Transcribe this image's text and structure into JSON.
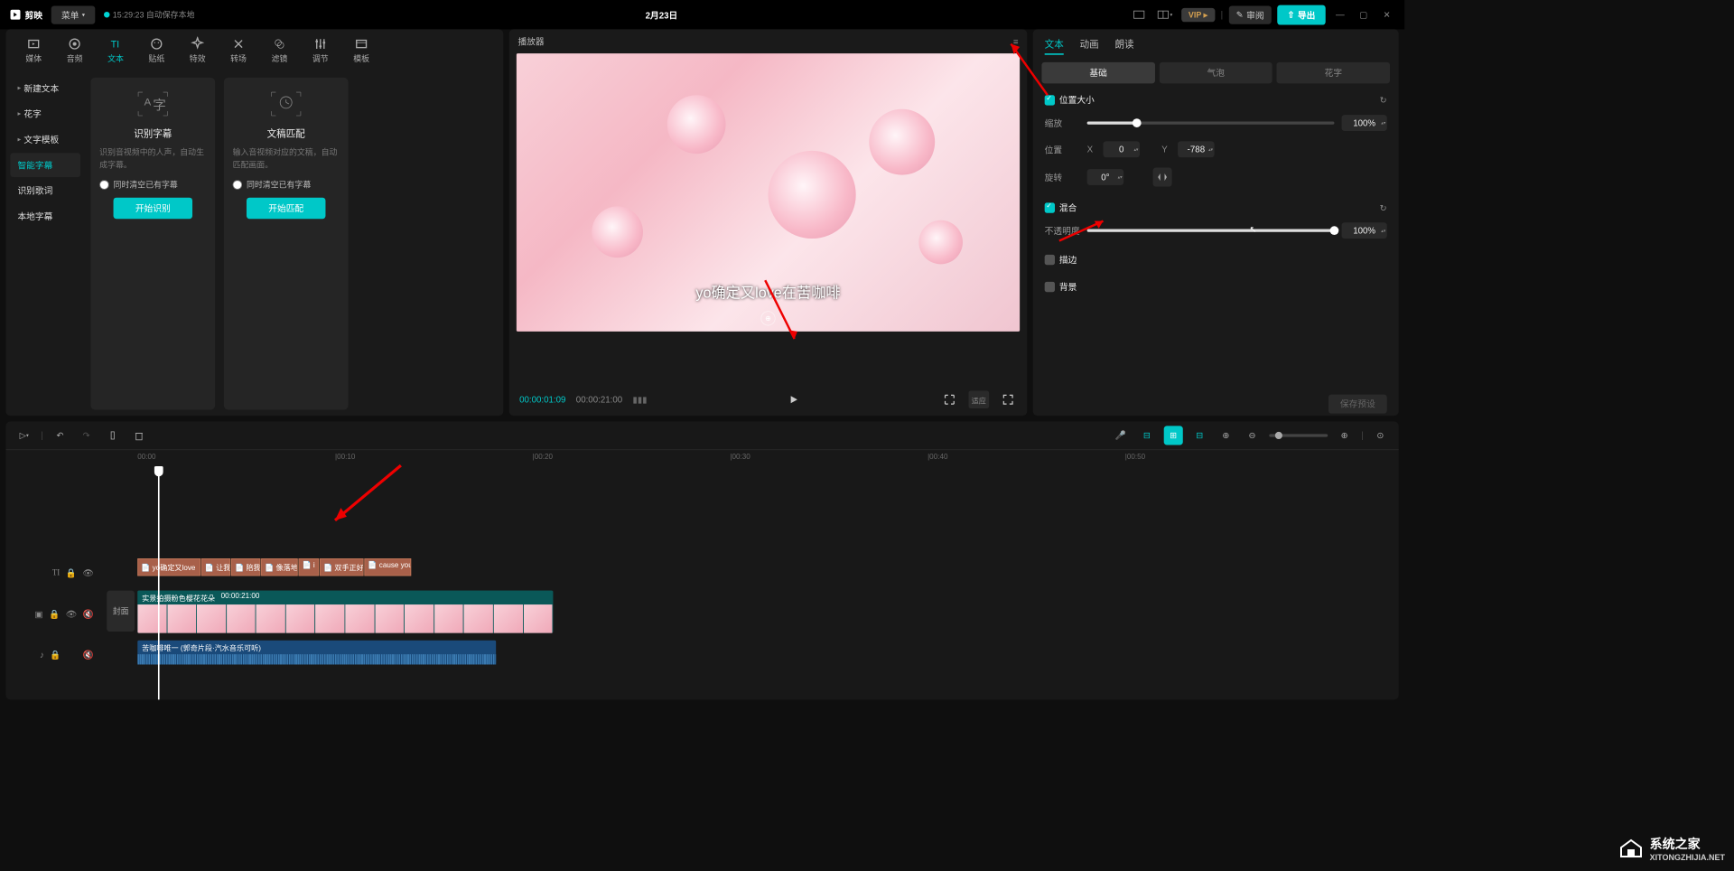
{
  "titlebar": {
    "app_name": "剪映",
    "menu": "菜单",
    "autosave": "15:29:23 自动保存本地",
    "project_title": "2月23日",
    "vip": "VIP",
    "review": "审阅",
    "export": "导出"
  },
  "top_tabs": [
    {
      "label": "媒体"
    },
    {
      "label": "音频"
    },
    {
      "label": "文本"
    },
    {
      "label": "贴纸"
    },
    {
      "label": "特效"
    },
    {
      "label": "转场"
    },
    {
      "label": "滤镜"
    },
    {
      "label": "调节"
    },
    {
      "label": "模板"
    }
  ],
  "side_nav": [
    {
      "label": "新建文本",
      "arrow": true
    },
    {
      "label": "花字",
      "arrow": true
    },
    {
      "label": "文字模板",
      "arrow": true
    },
    {
      "label": "智能字幕",
      "active": true
    },
    {
      "label": "识别歌词"
    },
    {
      "label": "本地字幕"
    }
  ],
  "cards": {
    "recognize": {
      "title": "识别字幕",
      "desc": "识别音视频中的人声，自动生成字幕。",
      "check": "同时清空已有字幕",
      "btn": "开始识别"
    },
    "match": {
      "title": "文稿匹配",
      "desc": "输入音视频对应的文稿，自动匹配画面。",
      "check": "同时清空已有字幕",
      "btn": "开始匹配"
    }
  },
  "player": {
    "title": "播放器",
    "subtitle_text": "yo确定又love在苦咖啡",
    "time_current": "00:00:01:09",
    "time_total": "00:00:21:00"
  },
  "props": {
    "tabs": [
      "文本",
      "动画",
      "朗读"
    ],
    "sub_tabs": [
      "基础",
      "气泡",
      "花字"
    ],
    "pos_size": "位置大小",
    "scale": "缩放",
    "scale_val": "100%",
    "position": "位置",
    "pos_x": "0",
    "pos_y": "-788",
    "rotation": "旋转",
    "rotation_val": "0°",
    "blend": "混合",
    "opacity": "不透明度",
    "opacity_val": "100%",
    "stroke": "描边",
    "background": "背景",
    "save_preset": "保存预设"
  },
  "timeline": {
    "ruler": [
      "00:00",
      "|00:10",
      "|00:20",
      "|00:30",
      "|00:40",
      "|00:50"
    ],
    "text_clips": [
      "yo确定又love",
      "让我",
      "陪我",
      "像落地",
      "i",
      "双手正好",
      "cause you c"
    ],
    "video_name": "实景拍摄粉色樱花花朵",
    "video_dur": "00:00:21:00",
    "cover": "封面",
    "audio_name": "苦咖啡唯一 (郭奇片段·汽水音乐可听)"
  },
  "watermark": {
    "main": "系统之家",
    "sub": "XITONGZHIJIA.NET"
  }
}
